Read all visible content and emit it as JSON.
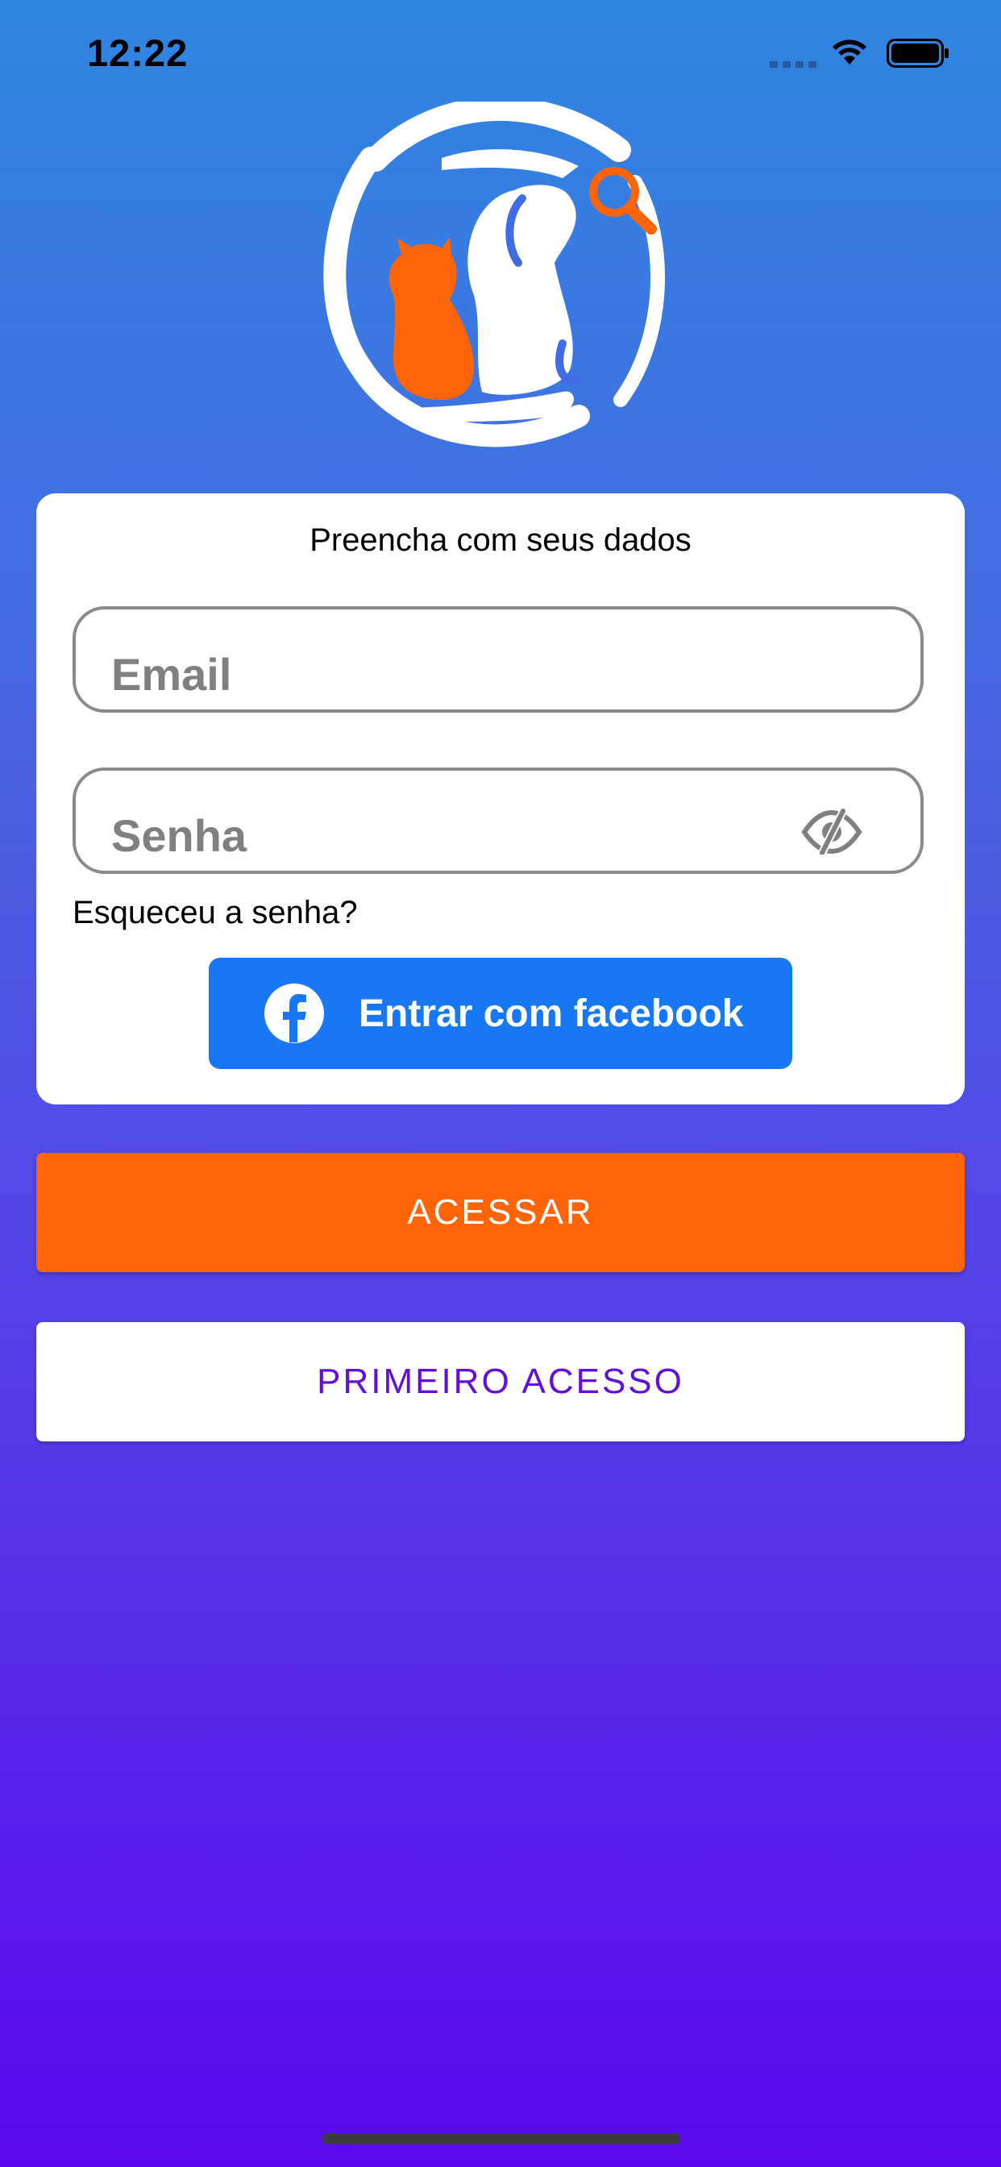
{
  "status_bar": {
    "time": "12:22",
    "icons": [
      "cellular-icon",
      "wifi-icon",
      "battery-icon"
    ]
  },
  "logo": {
    "name": "pet-search-logo",
    "colors": {
      "primary": "#ffffff",
      "accent": "#ff6406"
    }
  },
  "card": {
    "title": "Preencha com seus dados",
    "email": {
      "placeholder": "Email",
      "value": ""
    },
    "senha": {
      "placeholder": "Senha",
      "value": "",
      "toggle_icon": "eye-slash-icon"
    },
    "forgot_label": "Esqueceu a senha?",
    "facebook_label": "Entrar com facebook"
  },
  "buttons": {
    "acessar": "ACESSAR",
    "primeiro_acesso": "PRIMEIRO ACESSO"
  },
  "colors": {
    "orange": "#ff6406",
    "facebook": "#1877f2",
    "purple_text": "#6210d8"
  }
}
